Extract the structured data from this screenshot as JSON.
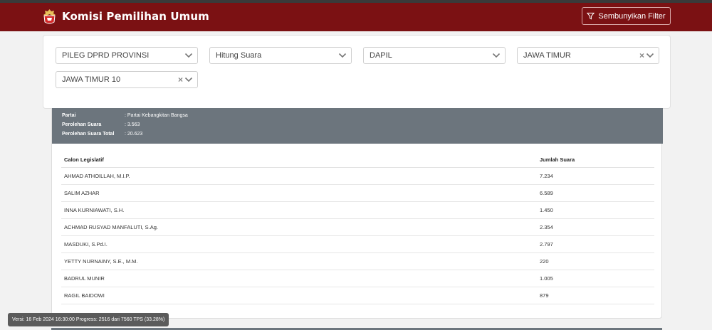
{
  "header": {
    "app_title": "Komisi Pemilihan Umum",
    "filter_toggle_label": "Sembunyikan Filter"
  },
  "filters": {
    "election_type": "PILEG DPRD PROVINSI",
    "mode": "Hitung Suara",
    "region_level": "DAPIL",
    "province": "JAWA TIMUR",
    "district": "JAWA TIMUR 10"
  },
  "party": {
    "party_label": "Partai",
    "party_value": ": Partai Kebangkitan Bangsa",
    "votes_label": "Perolehan Suara",
    "votes_value": ": 3.563",
    "total_label": "Perolehan Suara Total",
    "total_value": ": 20.623"
  },
  "table": {
    "col_candidate": "Calon Legislatif",
    "col_votes": "Jumlah Suara",
    "rows": [
      {
        "name": "AHMAD ATHOILLAH, M.I.P.",
        "votes": "7.234"
      },
      {
        "name": "SALIM AZHAR",
        "votes": "6.589"
      },
      {
        "name": "INNA KURNIAWATI, S.H.",
        "votes": "1.450"
      },
      {
        "name": "ACHMAD RUSYAD MANFALUTI, S.Ag.",
        "votes": "2.354"
      },
      {
        "name": "MASDUKI, S.Pd.I.",
        "votes": "2.797"
      },
      {
        "name": "YETTY NURNAINY, S.E., M.M.",
        "votes": "220"
      },
      {
        "name": "BADRUL MUNIR",
        "votes": "1.005"
      },
      {
        "name": "RAGIL BAIDOWI",
        "votes": "879"
      }
    ]
  },
  "footer": {
    "version_text": "Versi: 16 Feb 2024 16:30:00 Progress: 2516 dari 7560 TPS (33.28%)"
  },
  "colors": {
    "navbar": "#7b1113",
    "party_header": "#6c757d"
  },
  "icons": {
    "brand": "kpu-logo-icon",
    "filter": "funnel-icon",
    "dropdown": "chevron-down-icon",
    "clear": "clear-x-icon"
  }
}
